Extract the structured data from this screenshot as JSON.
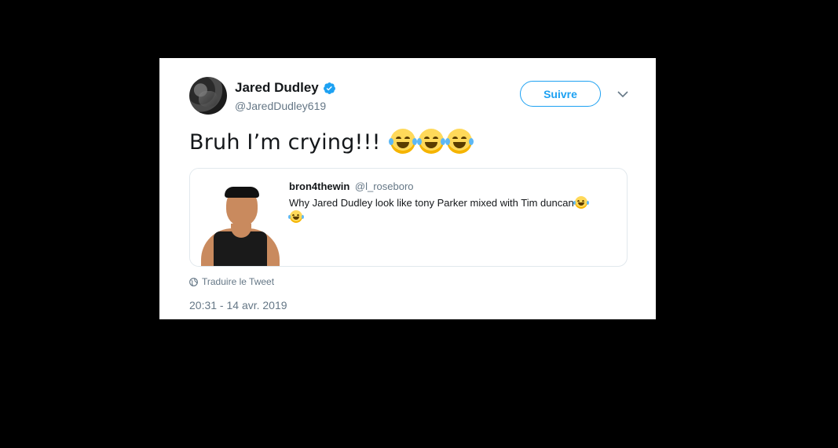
{
  "author": {
    "name": "Jared Dudley",
    "handle": "@JaredDudley619",
    "verified": true
  },
  "follow_button": "Suivre",
  "tweet": {
    "text": "Bruh I’m crying!!!",
    "emojis": [
      "face-with-tears-of-joy",
      "face-with-tears-of-joy",
      "face-with-tears-of-joy"
    ]
  },
  "quoted_tweet": {
    "name": "bron4thewin",
    "handle": "@l_roseboro",
    "text": "Why Jared Dudley look like tony Parker mixed with Tim duncan",
    "emojis": [
      "face-with-tears-of-joy",
      "face-with-tears-of-joy"
    ]
  },
  "translate_label": "Traduire le Tweet",
  "timestamp": "20:31 - 14 avr. 2019",
  "colors": {
    "accent": "#1da1f2",
    "secondary_text": "#657786",
    "border": "#e1e8ed"
  }
}
